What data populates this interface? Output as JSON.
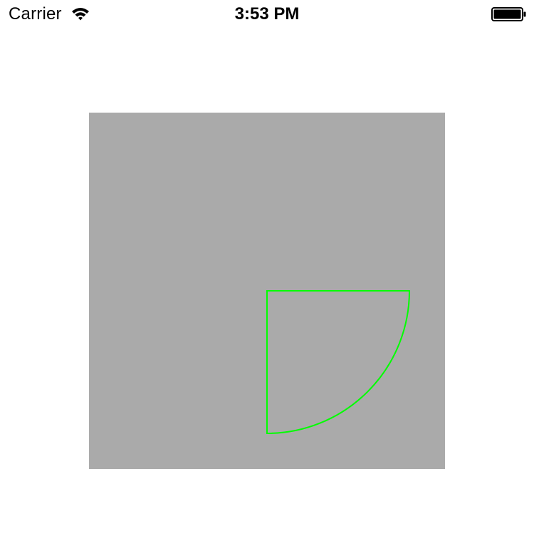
{
  "status_bar": {
    "carrier": "Carrier",
    "time": "3:53 PM",
    "wifi_icon": "wifi-icon",
    "battery_icon": "battery-icon"
  },
  "canvas": {
    "background_color": "#aaaaaa",
    "shape": "quarter-circle-sector",
    "shape_stroke_color": "#00ff00"
  }
}
